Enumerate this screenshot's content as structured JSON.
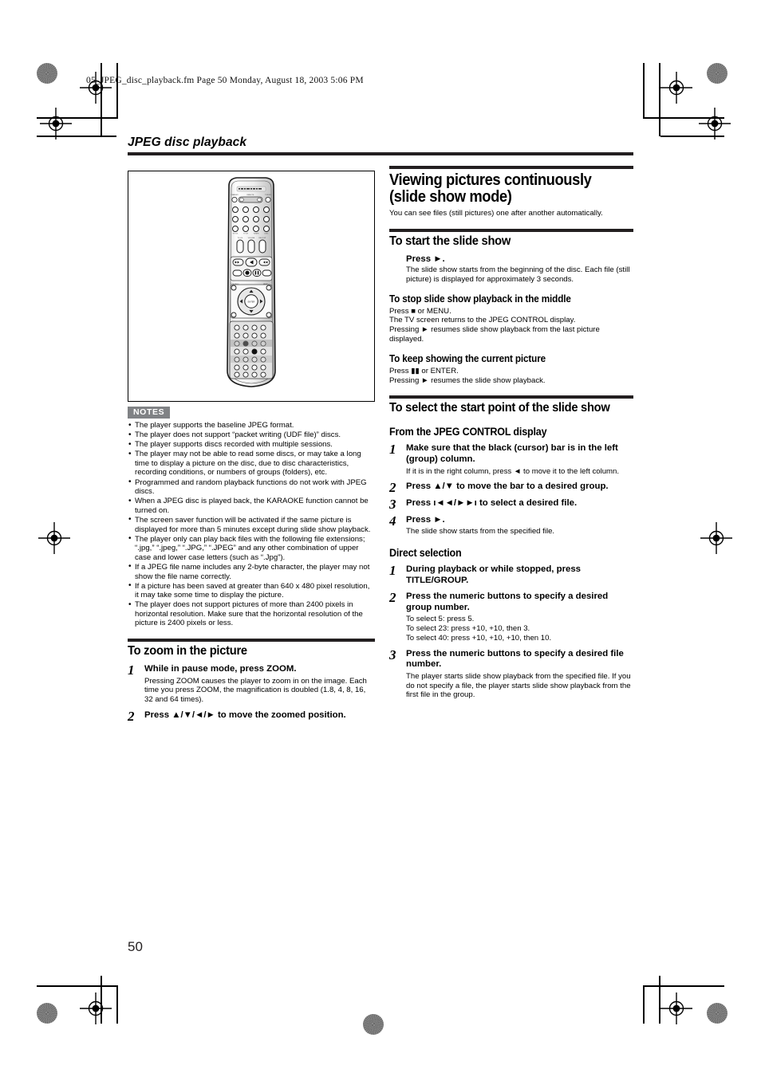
{
  "print_marks": {
    "file_header": "05_JPEG_disc_playback.fm  Page 50  Monday, August 18, 2003  5:06 PM"
  },
  "running_head": {
    "title": "JPEG disc playback"
  },
  "page_number": "50",
  "figure": {
    "caption": "",
    "alt_name": "remote-control-illustration",
    "display_label": "COMPU TRAEL DIGITAL AUDIO"
  },
  "notes": {
    "badge": "NOTES",
    "items": [
      "The player supports the baseline JPEG format.",
      "The player does not support “packet writing (UDF file)” discs.",
      "The player supports discs recorded with multiple sessions.",
      "The player may not be able to read some discs, or may take a long time to display a picture on the disc, due to disc characteristics, recording conditions, or numbers of groups (folders), etc.",
      "Programmed and random playback functions do not work with JPEG discs.",
      "When a JPEG disc is played back, the KARAOKE function cannot be turned on.",
      "The screen saver function will be activated if the same picture is displayed for more than 5 minutes except during slide show playback.",
      "The player only can play back files with the following file extensions; “.jpg,” “.jpeg,” “.JPG,” “.JPEG” and any other combination of upper case and lower case letters (such as “.Jpg”).",
      "If a JPEG file name includes any 2-byte character, the player may not show the file name correctly.",
      "If a picture has been saved at greater than 640 x 480 pixel resolution, it may take some time to display the picture.",
      "The player does not support pictures of more than 2400 pixels in horizontal resolution. Make sure that the horizontal resolution of the picture is 2400 pixels or less."
    ]
  },
  "zoom_section": {
    "heading": "To zoom in the picture",
    "steps": [
      {
        "num": "1",
        "title": "While in pause mode, press ZOOM.",
        "body": "Pressing ZOOM causes the player to zoom in on the image. Each time you press ZOOM, the magnification is doubled (1.8, 4, 8, 16, 32 and 64 times)."
      },
      {
        "num": "2",
        "title": "Press ▲/▼/◄/► to move the zoomed position.",
        "body": ""
      }
    ]
  },
  "slideshow": {
    "heading": "Viewing pictures continuously (slide show mode)",
    "intro": "You can see files (still pictures) one after another automatically.",
    "start": {
      "heading": "To start the slide show",
      "step_title": "Press ►.",
      "step_body": "The slide show starts from the beginning of the disc. Each file (still picture) is displayed for approximately 3 seconds."
    },
    "stop": {
      "heading": "To stop slide show playback in the middle",
      "lines": [
        "Press ■ or MENU.",
        "The TV screen returns to the JPEG CONTROL display.",
        "Pressing ► resumes slide show playback from the last picture displayed."
      ]
    },
    "keep": {
      "heading": "To keep showing the current picture",
      "lines": [
        "Press ▮▮ or ENTER.",
        "Pressing ► resumes the slide show playback."
      ]
    }
  },
  "select_start": {
    "heading": "To select the start point of the slide show",
    "from_control": {
      "heading": "From the JPEG CONTROL display",
      "steps": [
        {
          "num": "1",
          "title": "Make sure that the black (cursor) bar is in the left (group) column.",
          "body": "If it is in the right column, press ◄ to move it to the left column."
        },
        {
          "num": "2",
          "title": "Press ▲/▼  to move the bar to a desired group.",
          "body": ""
        },
        {
          "num": "3",
          "title": "Press ı◄◄/►►ı to select a desired file.",
          "body": ""
        },
        {
          "num": "4",
          "title": "Press ►.",
          "body": "The slide show starts from the specified file."
        }
      ]
    },
    "direct": {
      "heading": "Direct selection",
      "steps": [
        {
          "num": "1",
          "title": "During playback or while stopped, press TITLE/GROUP.",
          "body": ""
        },
        {
          "num": "2",
          "title": "Press the numeric buttons to specify a desired group number.",
          "body": "To select 5: press 5.\nTo select 23: press +10, +10, then 3.\nTo select 40: press +10, +10, +10, then 10."
        },
        {
          "num": "3",
          "title": "Press the numeric buttons to specify a desired file number.",
          "body": "The player starts slide show playback from the specified file. If you do not specify a file, the player starts slide show playback from the first file in the group."
        }
      ]
    }
  },
  "colors": {
    "rule": "#231f20",
    "badge_bg": "#808285",
    "text": "#000000"
  }
}
